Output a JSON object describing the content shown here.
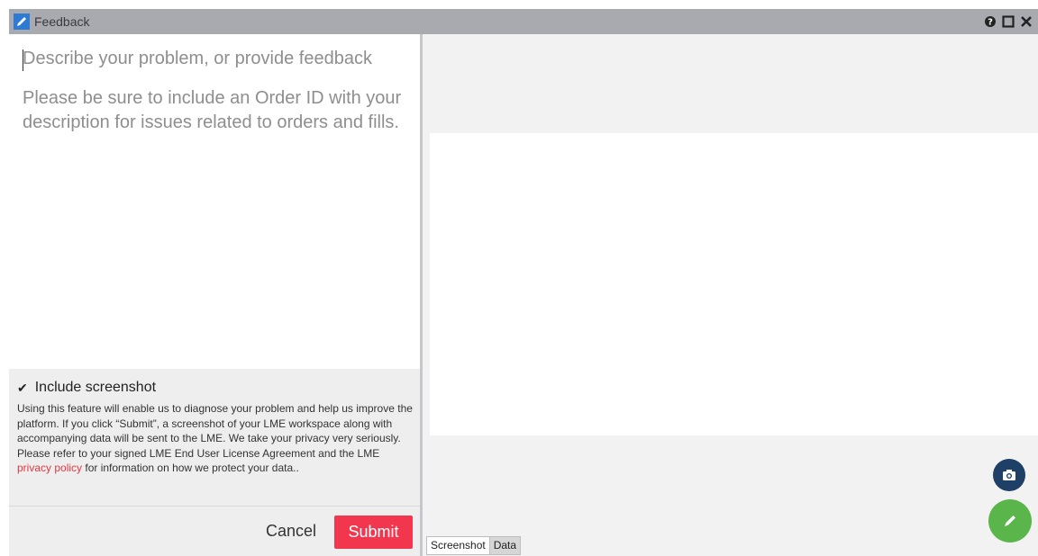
{
  "window": {
    "title": "Feedback",
    "colors": {
      "titlebar": "#a9aab0",
      "title_icon": "#2e7bd6"
    }
  },
  "feedback": {
    "placeholder_line1": "Describe your problem, or provide feedback",
    "placeholder_line2": "Please be sure to include an Order ID with your description for issues related to orders and fills."
  },
  "consent": {
    "checkbox_checked": true,
    "checkbox_mark": "✔",
    "checkbox_label": "Include screenshot",
    "text_before_link": "Using this feature will enable us to diagnose your problem and help us improve the platform. If you click “Submit”, a screenshot of your LME workspace along with accompanying data will be sent to the LME. We take your privacy very seriously. Please refer to your signed LME End User License Agreement and the LME ",
    "link_text": "privacy policy",
    "text_after_link": " for information on how we protect your data..",
    "link_color": "#e2393f"
  },
  "actions": {
    "cancel_label": "Cancel",
    "submit_label": "Submit",
    "submit_color": "#f1364e"
  },
  "preview": {
    "tabs": [
      {
        "label": "Screenshot",
        "active": true
      },
      {
        "label": "Data",
        "active": false
      }
    ],
    "camera_button_color": "#1e3f66",
    "edit_button_color": "#5ab64a"
  }
}
